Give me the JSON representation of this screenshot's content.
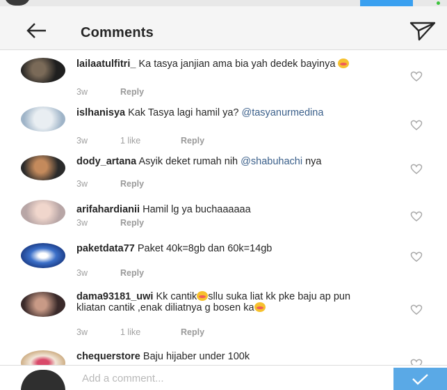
{
  "header": {
    "title": "Comments",
    "back_icon": "arrow-left-icon",
    "share_icon": "paper-plane-icon"
  },
  "colors": {
    "mention": "#3a5f8a",
    "meta_text": "#a0a0a0",
    "send_button": "#5aa9e6",
    "header_bg": "#f5f5f5"
  },
  "comments": [
    {
      "username": "lailaatulfitri_",
      "text": " Ka tasya janjian ama bia yah dedek bayinya ",
      "emoji": true,
      "time": "3w",
      "likes": "",
      "reply": "Reply"
    },
    {
      "username": "islhanisya",
      "text": " Kak Tasya lagi hamil ya? ",
      "mention": "@tasyanurmedina",
      "time": "3w",
      "likes": "1 like",
      "reply": "Reply"
    },
    {
      "username": "dody_artana",
      "text": " Asyik deket rumah nih ",
      "mention": "@shabuhachi",
      "text_after": " nya",
      "time": "3w",
      "likes": "",
      "reply": "Reply"
    },
    {
      "username": "arifahardianii",
      "text": " Hamil lg ya buchaaaaaa",
      "time": "3w",
      "likes": "",
      "reply": "Reply"
    },
    {
      "username": "paketdata77",
      "text": " Paket 40k=8gb dan 60k=14gb",
      "time": "3w",
      "likes": "",
      "reply": "Reply"
    },
    {
      "username": "dama93181_uwi",
      "text": " Kk cantik",
      "text_after": "sllu suka liat kk pke baju ap pun kliatan cantik ,enak diliatnya g bosen ka",
      "time": "3w",
      "likes": "1 like",
      "reply": "Reply"
    },
    {
      "username": "chequerstore",
      "text": " Baju hijaber under 100k"
    }
  ],
  "composer": {
    "placeholder": "Add a comment...",
    "send_icon": "checkmark-icon"
  }
}
